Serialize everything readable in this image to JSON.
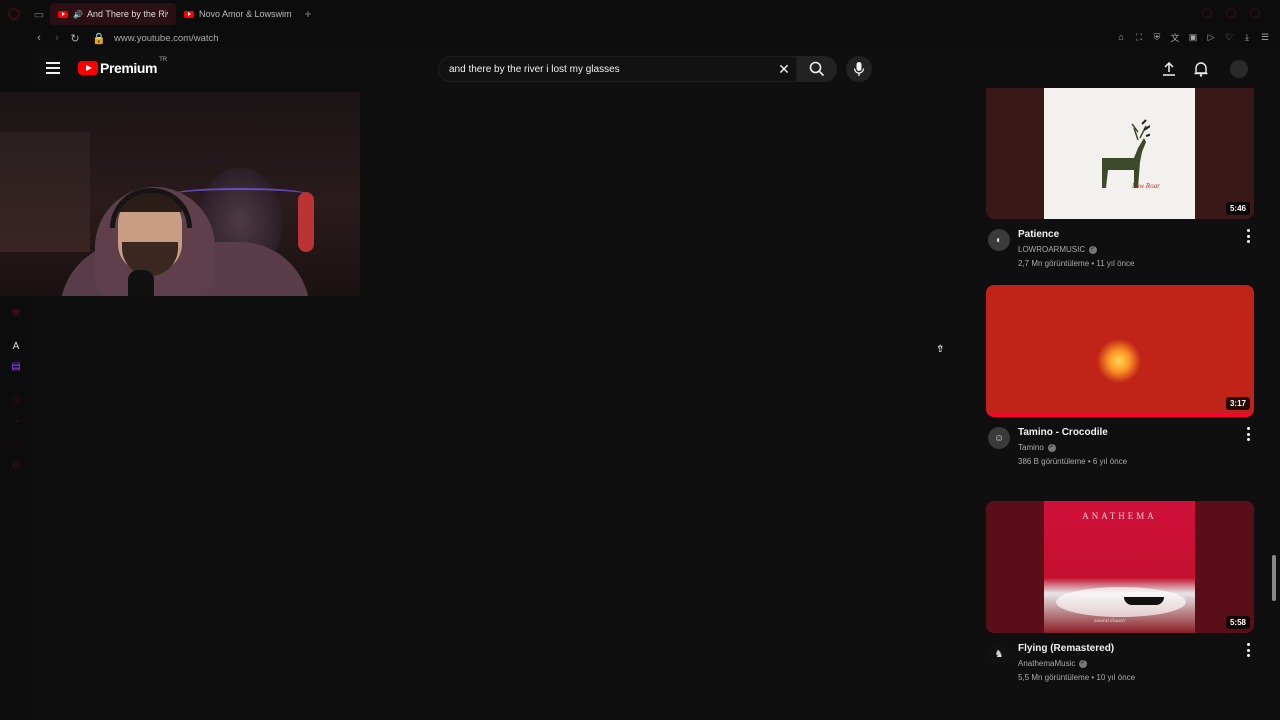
{
  "browser": {
    "tabs": [
      {
        "label": "And There by the Rive",
        "active": true
      },
      {
        "label": "Novo Amor & Lowswimme",
        "active": false
      }
    ],
    "url": "www.youtube.com/watch"
  },
  "youtube": {
    "logo_text": "Premium",
    "country_code": "TR",
    "search_query": "and there by the river i lost my glasses"
  },
  "videos": [
    {
      "title": "Patience",
      "channel": "LOWROARMUSIC",
      "stats": "2,7 Mn görüntüleme • 11 yıl önce",
      "duration": "5:46",
      "thumb_text": "Low Roar"
    },
    {
      "title": "Tamino - Crocodile",
      "channel": "Tamino",
      "stats": "386 B görüntüleme • 6 yıl önce",
      "duration": "3:17"
    },
    {
      "title": "Flying (Remastered)",
      "channel": "AnathemaMusic",
      "stats": "5,5 Mn görüntüleme • 10 yıl önce",
      "duration": "5:58",
      "thumb_text": "ANATHEMA",
      "thumb_subtext": "natural disaster"
    }
  ],
  "colors": {
    "accent": "#ff0000",
    "background": "#0f0f0f",
    "text": "#f1f1f1",
    "secondary_text": "#aaaaaa"
  }
}
